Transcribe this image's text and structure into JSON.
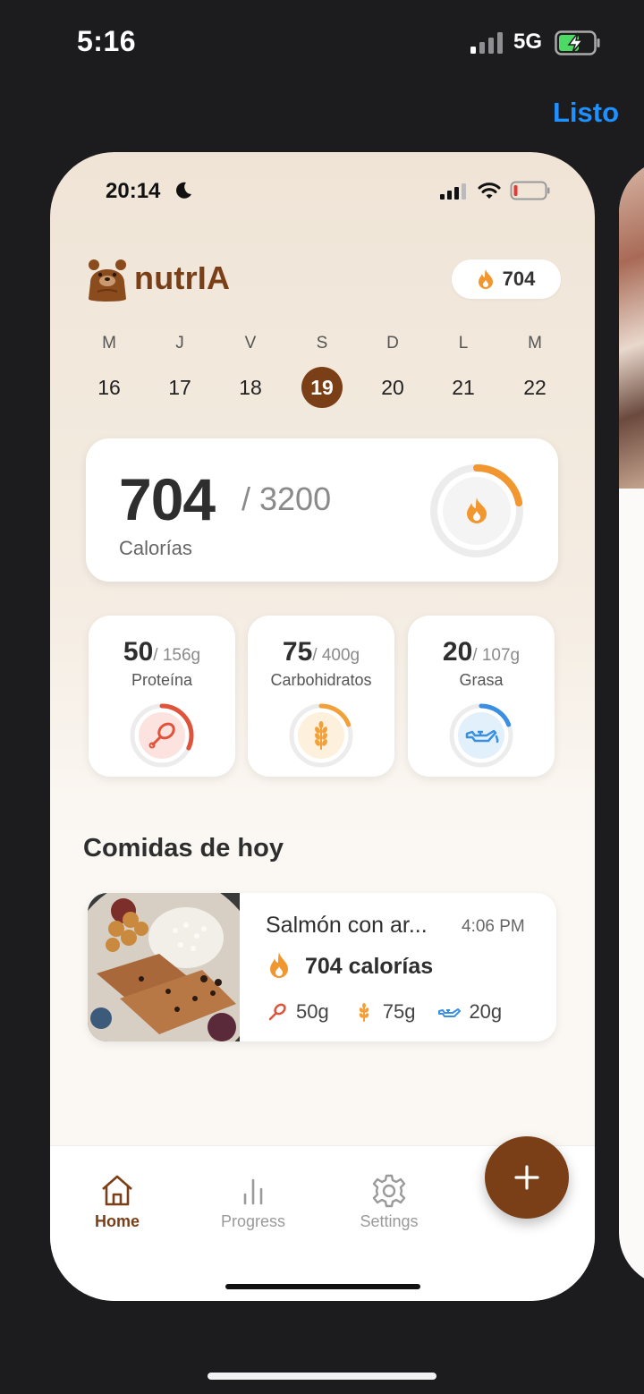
{
  "outer_status": {
    "time": "5:16",
    "network": "5G"
  },
  "done_label": "Listo",
  "inner_status": {
    "time": "20:14"
  },
  "header": {
    "app_name": "nutrIA",
    "streak_value": "704"
  },
  "week": [
    {
      "letter": "M",
      "num": "16",
      "selected": false
    },
    {
      "letter": "J",
      "num": "17",
      "selected": false
    },
    {
      "letter": "V",
      "num": "18",
      "selected": false
    },
    {
      "letter": "S",
      "num": "19",
      "selected": true
    },
    {
      "letter": "D",
      "num": "20",
      "selected": false
    },
    {
      "letter": "L",
      "num": "21",
      "selected": false
    },
    {
      "letter": "M",
      "num": "22",
      "selected": false
    }
  ],
  "calories": {
    "value": "704",
    "goal": "/ 3200",
    "label": "Calorías",
    "progress": 0.22,
    "ring_color": "#f2962f",
    "icon": "flame-icon"
  },
  "macros": [
    {
      "value": "50",
      "goal": "/ 156g",
      "label": "Proteína",
      "progress": 0.32,
      "color": "#e0533b",
      "icon": "drumstick-icon"
    },
    {
      "value": "75",
      "goal": "/ 400g",
      "label": "Carbohidratos",
      "progress": 0.19,
      "color": "#f2a03a",
      "icon": "wheat-icon"
    },
    {
      "value": "20",
      "goal": "/ 107g",
      "label": "Grasa",
      "progress": 0.19,
      "color": "#3b8fe0",
      "icon": "oil-can-icon"
    }
  ],
  "section_title": "Comidas de hoy",
  "meal": {
    "name": "Salmón con ar...",
    "time": "4:06 PM",
    "calories": "704 calorías",
    "protein": "50g",
    "carbs": "75g",
    "fat": "20g"
  },
  "tabs": [
    {
      "label": "Home",
      "icon": "home-icon",
      "active": true
    },
    {
      "label": "Progress",
      "icon": "bar-chart-icon",
      "active": false
    },
    {
      "label": "Settings",
      "icon": "gear-icon",
      "active": false
    }
  ],
  "colors": {
    "brand": "#7a3f17",
    "accent_blue": "#1e90ff"
  }
}
